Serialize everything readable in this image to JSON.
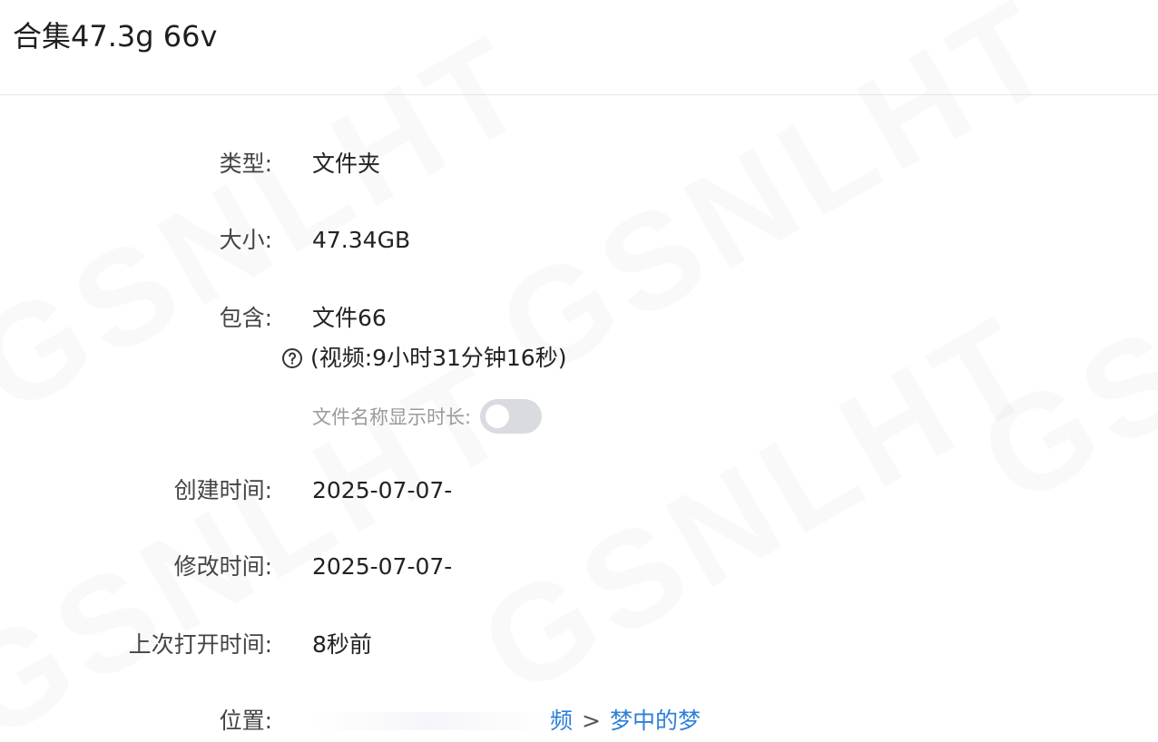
{
  "title": "合集47.3g 66v",
  "rows": {
    "type": {
      "label": "类型:",
      "value": "文件夹"
    },
    "size": {
      "label": "大小:",
      "value": "47.34GB"
    },
    "contains": {
      "label": "包含:",
      "value": "文件66",
      "video_duration": "(视频:9小时31分钟16秒)",
      "toggle_label": "文件名称显示时长:",
      "toggle_on": false
    },
    "created": {
      "label": "创建时间:",
      "value": "2025-07-07-"
    },
    "modified": {
      "label": "修改时间:",
      "value": "2025-07-07-"
    },
    "last_opened": {
      "label": "上次打开时间:",
      "value": "8秒前"
    },
    "location": {
      "label": "位置:",
      "path_partial": "频",
      "separator": ">",
      "current": "梦中的梦"
    }
  },
  "icons": {
    "help": "question-circle-icon"
  },
  "colors": {
    "link": "#2f7fd8",
    "toggle_off": "#d9dbe0",
    "muted_text": "#9a9a9a"
  }
}
